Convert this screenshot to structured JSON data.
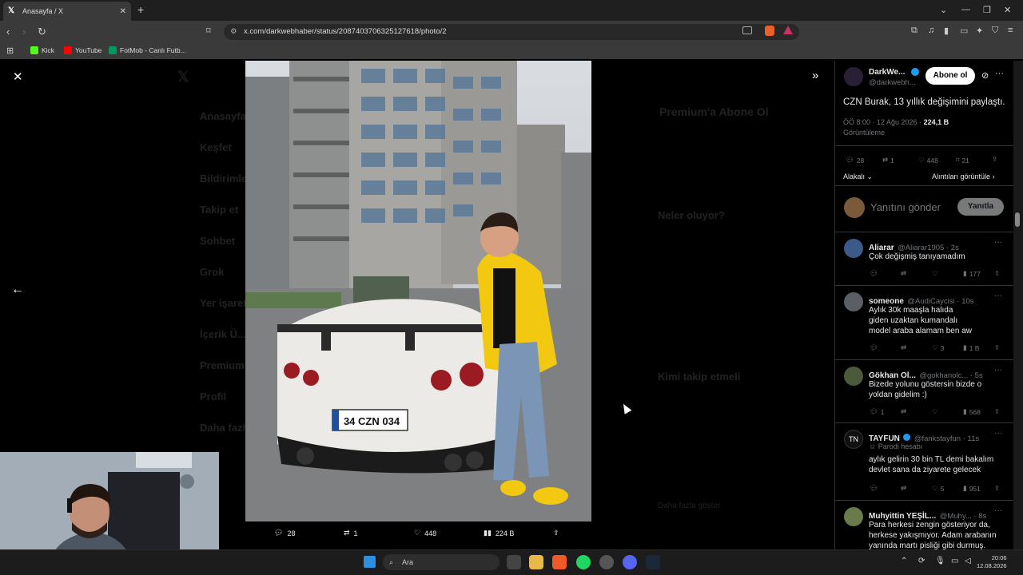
{
  "browser": {
    "tab_title": "Anasayfa / X",
    "url": "x.com/darkwebhaber/status/2087403706325127618/photo/2",
    "bookmarks": [
      "Kick",
      "YouTube",
      "FotMob - Canlı Futb..."
    ]
  },
  "background_nav": [
    "Anasayfa",
    "Keşfet",
    "Bildirimler",
    "Takip et",
    "Sohbet",
    "Grok",
    "Yer işaretleri",
    "İçerik Ü...",
    "Premium",
    "Profil",
    "Daha fazla"
  ],
  "background_right": {
    "premium_title": "Premium'a Abone Ol",
    "trends_title": "Neler oluyor?",
    "follow_title": "Kimi takip etmeli",
    "show_more": "Daha fazla göster"
  },
  "photo": {
    "plate": "34 CZN 034"
  },
  "action_bar": {
    "replies": "28",
    "reposts": "1",
    "likes": "448",
    "views": "224 B"
  },
  "tweet": {
    "author_name": "DarkWe...",
    "author_handle": "@darkwebh...",
    "subscribe_label": "Abone ol",
    "text": "CZN Burak, 13 yıllık değişimini paylaştı.",
    "time": "ÖÖ 8:00 · 12 Ağu 2026 · ",
    "views_count": "224,1 B",
    "views_label": "Görüntüleme",
    "replies": "28",
    "reposts": "1",
    "likes": "448",
    "bookmarks": "21",
    "sort_label": "Alakalı",
    "quotes_label": "Alıntıları görüntüle",
    "reply_placeholder": "Yanıtını gönder",
    "reply_button": "Yanıtla"
  },
  "replies": [
    {
      "name": "Aliarar",
      "handle": "@Aliarar1905 · 2s",
      "text": "Çok değişmiş tanıyamadım",
      "replies": "",
      "reposts": "",
      "likes": "",
      "views": "177"
    },
    {
      "name": "someone",
      "handle": "@AudiCaycisi · 10s",
      "text": "Aylık 30k maaşla halıda giden uzaktan kumandalı model araba alamam ben aw",
      "replies": "",
      "reposts": "",
      "likes": "3",
      "views": "1 B"
    },
    {
      "name": "Gökhan Ol...",
      "handle": "@gokhanolc... · 5s",
      "text": "Bizede yolunu göstersin bizde o yoldan gidelim :)",
      "replies": "1",
      "reposts": "",
      "likes": "",
      "views": "568"
    },
    {
      "name": "TAYFUN",
      "handle": "@fankstayfun · 11s",
      "badge": "Parodi hesabı",
      "text": "aylık gelirin 30 bin TL demi bakalım devlet sana da ziyarete gelecek",
      "replies": "",
      "reposts": "",
      "likes": "5",
      "views": "951"
    },
    {
      "name": "Muhyittin YEŞİL...",
      "handle": "@Muhy... · 8s",
      "text": "Para herkesi zengin gösteriyor da, herkese yakışmıyor. Adam arabanın yanında martı pisliği gibi durmuş.",
      "replies": "",
      "reposts": "",
      "likes": "",
      "views": ""
    }
  ],
  "taskbar": {
    "search_placeholder": "Ara",
    "time": "20:06",
    "date": "12.08.2026"
  },
  "colors": {
    "accent": "#1d9bf0",
    "panel_bg": "#000000",
    "chrome": "#3a3a3a",
    "yellow_jacket": "#f2c811"
  }
}
